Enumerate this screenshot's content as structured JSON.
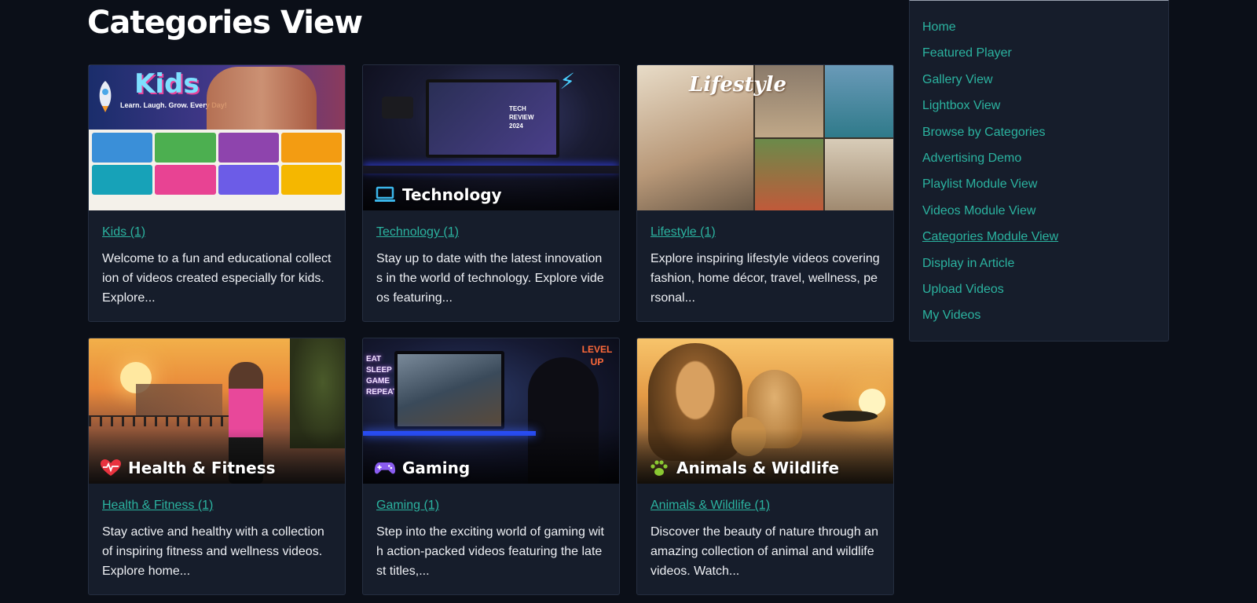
{
  "page": {
    "title": "Categories View"
  },
  "categories": [
    {
      "name": "Kids",
      "link_text": "Kids (1)",
      "description": "Welcome to a fun and educational collection of videos created especially for kids. Explore...",
      "thumb_title": "Kids",
      "thumb_tagline": "Learn. Laugh. Grow. Every Day!"
    },
    {
      "name": "Technology",
      "link_text": "Technology (1)",
      "description": "Stay up to date with the latest innovations in the world of technology. Explore videos featuring...",
      "thumb_title": "Technology",
      "thumb_icon": "laptop-icon",
      "thumb_screen_text": "TECH REVIEW 2024"
    },
    {
      "name": "Lifestyle",
      "link_text": "Lifestyle (1)",
      "description": "Explore inspiring lifestyle videos covering fashion, home décor, travel, wellness, personal...",
      "thumb_title": "Lifestyle"
    },
    {
      "name": "Health & Fitness",
      "link_text": "Health & Fitness (1)",
      "description": "Stay active and healthy with a collection of inspiring fitness and wellness videos. Explore home...",
      "thumb_title": "Health & Fitness",
      "thumb_icon": "heartbeat-icon"
    },
    {
      "name": "Gaming",
      "link_text": "Gaming (1)",
      "description": "Step into the exciting world of gaming with action-packed videos featuring the latest titles,...",
      "thumb_title": "Gaming",
      "thumb_icon": "gamepad-icon",
      "thumb_neon_text": "EAT SLEEP GAME REPEAT",
      "thumb_sign_text": "LEVEL UP"
    },
    {
      "name": "Animals & Wildlife",
      "link_text": "Animals & Wildlife (1)",
      "description": "Discover the beauty of nature through an amazing collection of animal and wildlife videos. Watch...",
      "thumb_title": "Animals & Wildlife",
      "thumb_icon": "paw-icon"
    }
  ],
  "sidebar": {
    "items": [
      {
        "label": "Home"
      },
      {
        "label": "Featured Player"
      },
      {
        "label": "Gallery View"
      },
      {
        "label": "Lightbox View"
      },
      {
        "label": "Browse by Categories"
      },
      {
        "label": "Advertising Demo"
      },
      {
        "label": "Playlist Module View"
      },
      {
        "label": "Videos Module View"
      },
      {
        "label": "Categories Module View",
        "active": true
      },
      {
        "label": "Display in Article"
      },
      {
        "label": "Upload Videos"
      },
      {
        "label": "My Videos"
      }
    ]
  },
  "colors": {
    "background": "#0b0f18",
    "card": "#161d2b",
    "link": "#2bb3a0",
    "text": "#eef0f4"
  }
}
